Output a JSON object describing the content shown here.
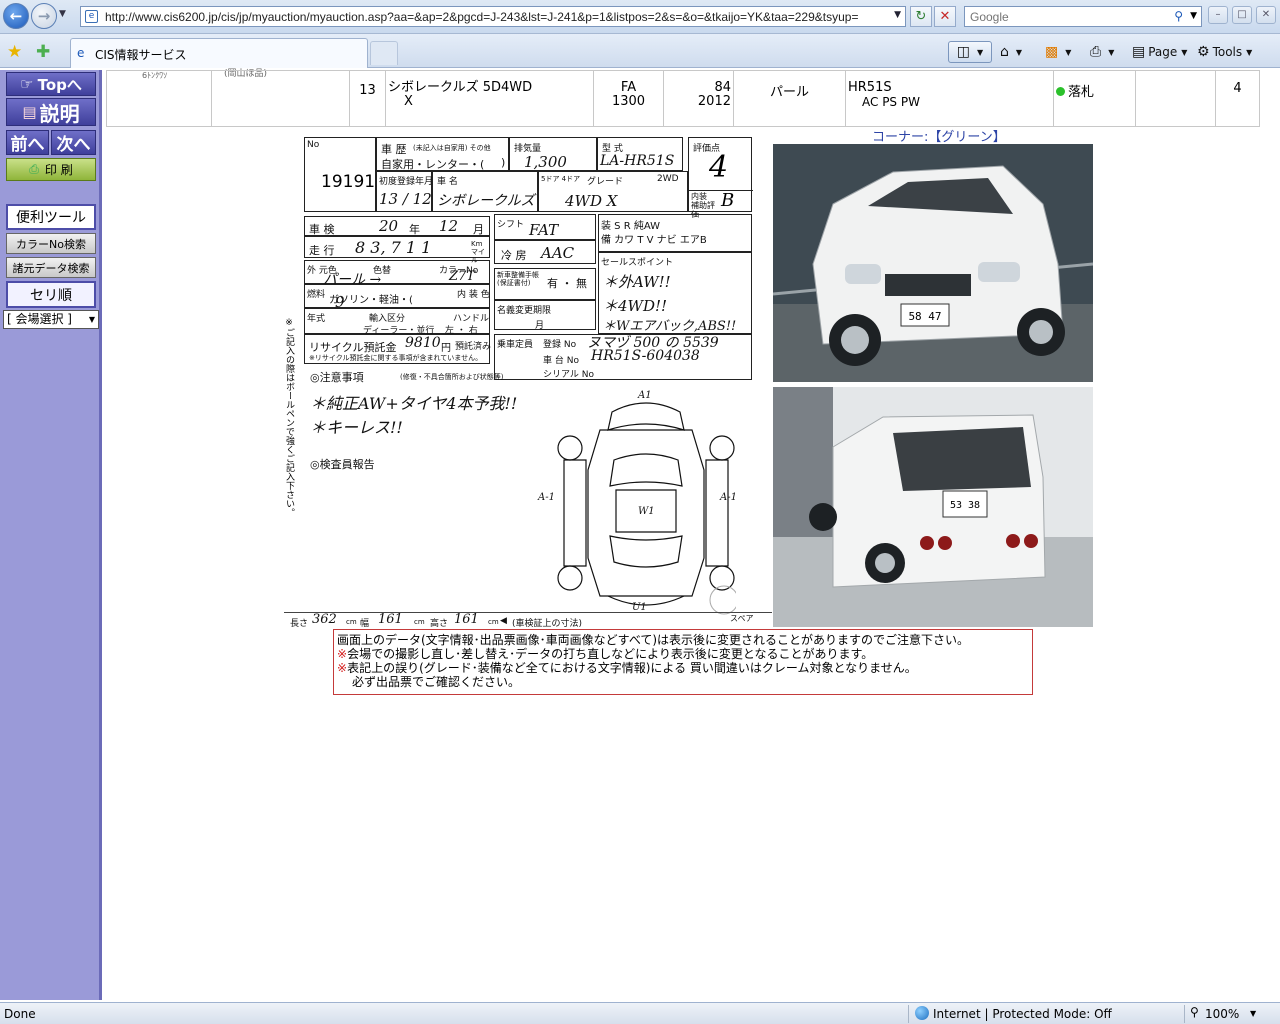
{
  "browser": {
    "url": "http://www.cis6200.jp/cis/jp/myauction/myauction.asp?aa=&ap=2&pgcd=J-243&lst=J-241&p=1&listpos=2&s=&o=&tkaijo=YK&taa=229&tsyup=",
    "search_placeholder": "Google",
    "tab_title": "CIS情報サービス",
    "commands": {
      "page": "Page",
      "tools": "Tools"
    },
    "status": "Done",
    "zone": "Internet | Protected Mode: Off",
    "zoom": "100%"
  },
  "sidebar": {
    "top": "Topへ",
    "explain": "説明",
    "prev": "前へ",
    "next": "次へ",
    "print": "印 刷",
    "tools_label": "便利ツール",
    "color_search": "カラーNo検索",
    "origin_search": "諸元データ検索",
    "seri_order": "セリ順",
    "venue_select": "[ 会場選択 ]"
  },
  "listing": {
    "clip_a": "6ﾄﾝｸﾜｿ",
    "clip_b": "(岡山ほ品)",
    "lot_seq": "13",
    "model": "シボレークルズ 5D4WD",
    "grade": "X",
    "trans": "FA",
    "cc": "1300",
    "year_code": "84",
    "price_code": "2012",
    "color": "パール",
    "chassis": "HR51S",
    "equip": "AC PS PW",
    "result": "落札",
    "score": "4"
  },
  "sheet": {
    "lot_no": "19191",
    "score": "4",
    "interior": "B",
    "labels": {
      "no": "No",
      "history": "車 歴",
      "history_sub": "(未記入は自家用) その他",
      "use": "自家用・レンター・(",
      "cc": "排気量",
      "model_type": "型 式",
      "score": "評価点",
      "first_reg": "初度登録年月",
      "car_name": "車 名",
      "doors": "5ドア 4ドア",
      "grade": "グレード",
      "drive": "2WD",
      "interior": "内装 補助評価",
      "inspection": "車 検",
      "year": "年",
      "month": "月",
      "mileage": "走 行",
      "km": "Km マイル",
      "shift": "シフト",
      "outer_color": "外 元色",
      "color_label": "色替",
      "color_no": "カラーNo",
      "inner_color": "内 装 色",
      "aircon": "冷 房",
      "fuel": "燃料",
      "fuel_types": "ガソリン・軽油・(",
      "import": "年式",
      "import_type": "輸入区分",
      "dealer": "ディーラー・並行",
      "handle": "ハンドル",
      "lr": "左 ・ 右",
      "recycle": "リサイクル預託金",
      "yen": "円",
      "deposited": "預託済み",
      "recycle_note": "※リサイクル預託金に関する事項が含まれていません。",
      "notes": "◎注意事項",
      "notes_sub": "(修復・不具合箇所および状態等)",
      "inspector": "◎検査員報告",
      "sales_point": "セールスポイント",
      "capacity": "乗車定員",
      "registration": "登録 No",
      "chassis_no": "車 台 No",
      "serial": "シリアル No",
      "name_change": "名義変更期限",
      "equip_row1": "装 S R 純AW",
      "equip_row2": "備 カワ T V ナビ エアB",
      "new_book": "新車整備手帳 (保証書付)",
      "have": "有 ・ 無",
      "spare": "スペア",
      "vert_note": "※ご記入の際はボールペンで強くご記入下さい。",
      "length": "長さ",
      "width": "幅",
      "height": "高さ",
      "cm": "cm",
      "footer_note": "(車検証上の寸法)"
    },
    "hand": {
      "use_other": ")",
      "cc": "1,300",
      "model_type": "LA-HR51S",
      "first_reg": "13 / 12",
      "car_name": "シボレークルズ",
      "grade": "4WD X",
      "inspection_year": "20",
      "inspection_month": "12",
      "mileage": "8 3, 7 1 1",
      "shift": "FAT",
      "color": "パール →",
      "color_no": "Z7T",
      "aircon": "AAC",
      "fuel": "9",
      "recycle_amount": "9810",
      "sales_point_1": "＊外AW!!",
      "sales_point_2": "＊4WD!!",
      "sales_point_3": "＊Wエアバック,ABS!!",
      "registration": "ヌマヅ 500 の 5539",
      "chassis_no": "HR51S-604038",
      "note_1": "＊純正AW+タイヤ4本予我!!",
      "note_2": "＊キーレス!!",
      "length": "362",
      "width": "161",
      "height": "161",
      "diag_a1": "A1",
      "diag_left": "A-1",
      "diag_right": "A-1",
      "diag_center": "W1",
      "diag_bottom": "U1"
    }
  },
  "corner_label": "コーナー:【グリーン】",
  "notice": {
    "line1": "画面上のデータ(文字情報･出品票画像･車両画像などすべて)は表示後に変更されることがありますのでご注意下さい。",
    "line2": "会場での撮影し直し･差し替え･データの打ち直しなどにより表示後に変更となることがあります。",
    "line3": "表記上の誤り(グレード･装備など全てにおける文字情報)による 買い間違いはクレーム対象となりません。",
    "line4": "必ず出品票でご確認ください。",
    "mark": "※"
  },
  "photo_plates": {
    "front": "58 47",
    "rear": "53 38"
  }
}
